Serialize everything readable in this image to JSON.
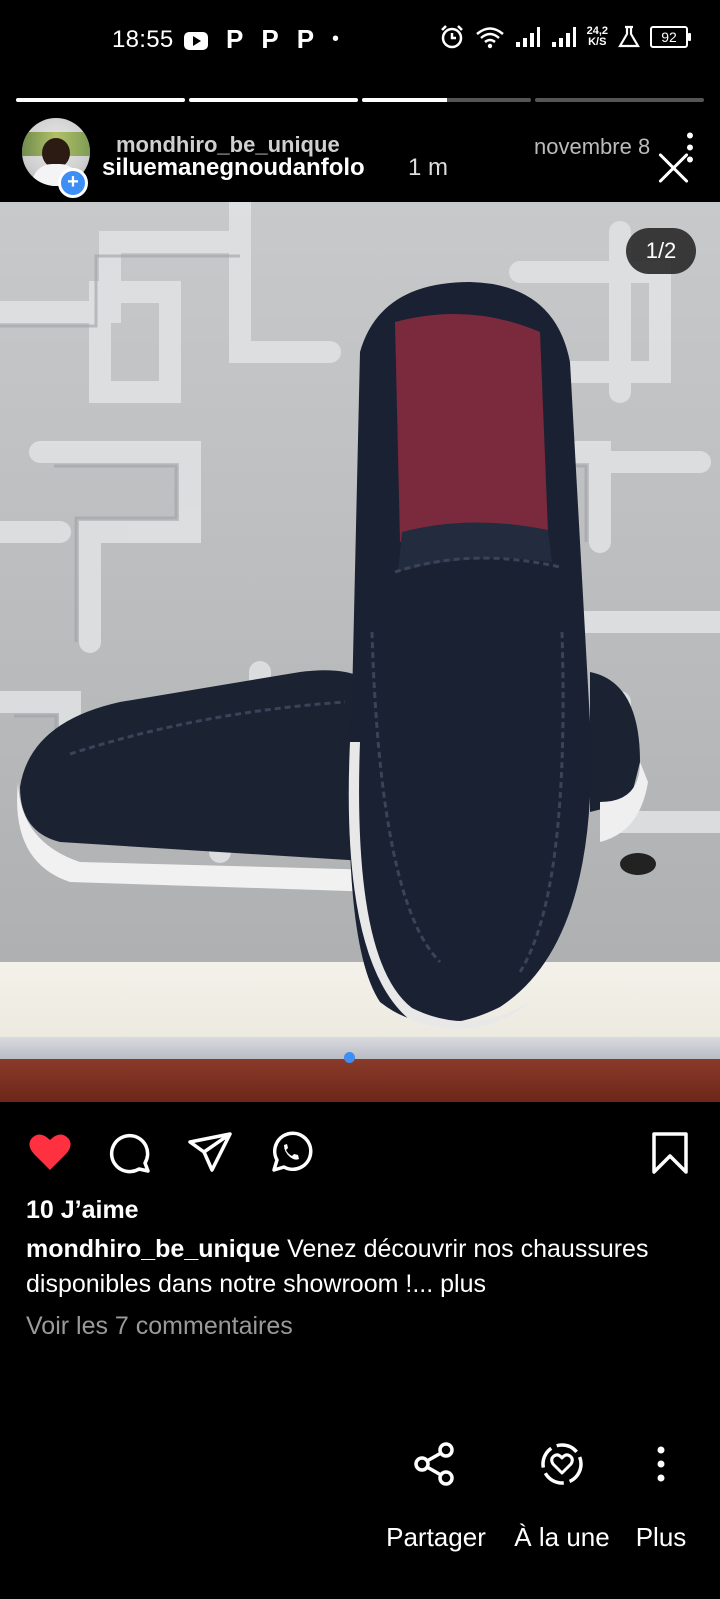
{
  "status_bar": {
    "time": "18:55",
    "notification_glyphs": [
      "P",
      "P",
      "P"
    ],
    "dot": "•",
    "net_speed_value": "24,2",
    "net_speed_unit": "K/S",
    "battery": "92"
  },
  "story": {
    "progress_segments": [
      1.0,
      1.0,
      0.5,
      0.0
    ],
    "owner_name": "mondhiro_be_unique",
    "user": "siluemanegnoudanfolo",
    "age": "1 m",
    "post_date": "novembre 8",
    "counter": "1/2"
  },
  "post": {
    "likes": "10 J’aime",
    "caption_user": "mondhiro_be_unique",
    "caption_text": " Venez découvrir nos chaussures disponibles dans notre showroom !...",
    "caption_more": " plus",
    "comments": "Voir les 7 commentaires"
  },
  "icons": {
    "like": "heart-icon",
    "comment": "comment-icon",
    "send": "send-icon",
    "whatsapp": "whatsapp-icon",
    "save": "bookmark-icon",
    "share": "share-icon",
    "highlight": "highlight-icon",
    "more": "more-vertical-icon",
    "close": "close-icon"
  },
  "colors": {
    "like": "#ff3040",
    "accent": "#3d8ff5",
    "muted": "#9a9a9a"
  },
  "bottom_actions": [
    {
      "label": "Partager"
    },
    {
      "label": "À la une"
    },
    {
      "label": "Plus"
    }
  ]
}
